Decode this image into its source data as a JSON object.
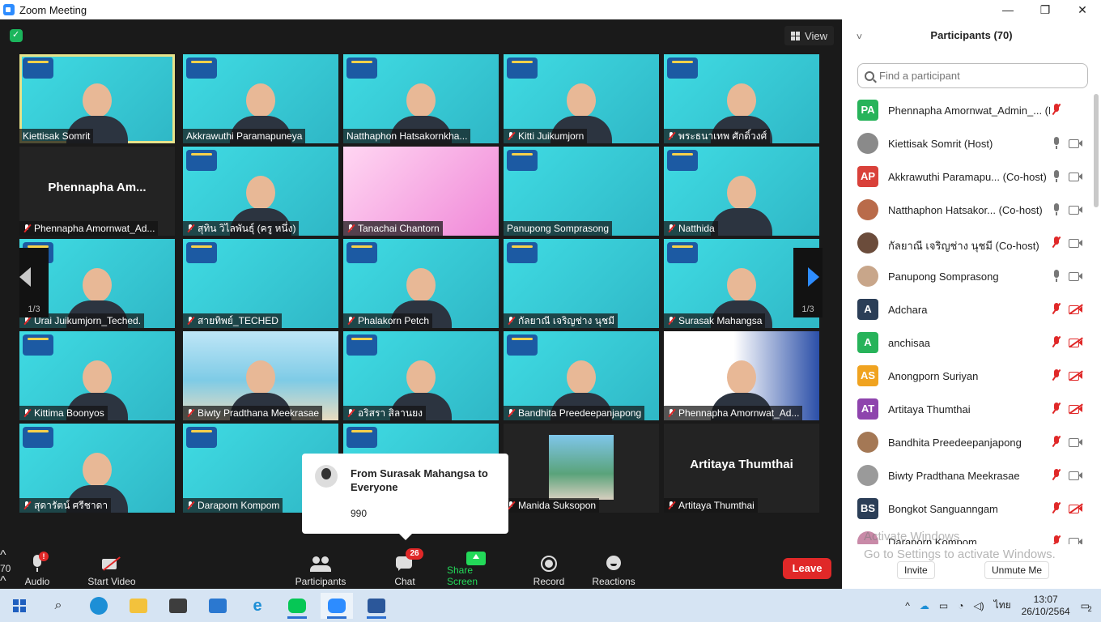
{
  "window": {
    "title": "Zoom Meeting",
    "controls": [
      "—",
      "❐",
      "✕"
    ]
  },
  "meeting": {
    "view_label": "View",
    "page_indicator": "1/3",
    "tiles": [
      {
        "name": "Kiettisak Somrit",
        "center": "",
        "kind": "cyan-person",
        "active": true,
        "muted": false
      },
      {
        "name": "Akkrawuthi Paramapuneya",
        "center": "",
        "kind": "cyan-person",
        "muted": false
      },
      {
        "name": "Natthaphon Hatsakornkha...",
        "center": "",
        "kind": "cyan-person",
        "muted": false
      },
      {
        "name": "Kitti Juikumjorn",
        "center": "",
        "kind": "cyan-person",
        "muted": true
      },
      {
        "name": "พระธนาเทพ ศักดิ์วงศ์",
        "center": "",
        "kind": "cyan-person",
        "muted": true
      },
      {
        "name": "Phennapha Amornwat_Ad...",
        "center": "Phennapha  Am...",
        "kind": "dark",
        "muted": true
      },
      {
        "name": "สุทิน วิไลพันธุ์ (ครู หนึ่ง)",
        "center": "",
        "kind": "cyan-person",
        "muted": true
      },
      {
        "name": "Tanachai Chantorn",
        "center": "",
        "kind": "pink",
        "muted": true
      },
      {
        "name": "Panupong Somprasong",
        "center": "",
        "kind": "cyan",
        "muted": false
      },
      {
        "name": "Natthida",
        "center": "",
        "kind": "cyan-person",
        "muted": true
      },
      {
        "name": "Urai Juikumjorn_Teched.",
        "center": "",
        "kind": "cyan-person",
        "muted": true
      },
      {
        "name": "สายทิพย์_TECHED",
        "center": "",
        "kind": "cyan",
        "muted": true
      },
      {
        "name": "Phalakorn Petch",
        "center": "",
        "kind": "cyan-person",
        "muted": true
      },
      {
        "name": "กัลยาณี เจริญช่าง นุชมี",
        "center": "",
        "kind": "cyan",
        "muted": true
      },
      {
        "name": "Surasak Mahangsa",
        "center": "",
        "kind": "cyan-person",
        "muted": true
      },
      {
        "name": "Kittima Boonyos",
        "center": "",
        "kind": "cyan-person",
        "muted": true
      },
      {
        "name": "Biwty Pradthana Meekrasae",
        "center": "",
        "kind": "beach",
        "muted": true
      },
      {
        "name": "อริสรา สิลานยง",
        "center": "",
        "kind": "cyan-person",
        "muted": true
      },
      {
        "name": "Bandhita Preedeepanjapong",
        "center": "",
        "kind": "cyan-person",
        "muted": true
      },
      {
        "name": "Phennapha Amornwat_Ad...",
        "center": "",
        "kind": "white-person",
        "muted": true
      },
      {
        "name": "สุดารัตน์ ศรีชาดา",
        "center": "",
        "kind": "cyan-person",
        "muted": true
      },
      {
        "name": "Daraporn Kompom",
        "center": "",
        "kind": "cyan",
        "muted": true
      },
      {
        "name": "",
        "center": "",
        "kind": "cyan",
        "muted": false
      },
      {
        "name": "Manida Suksopon",
        "center": "",
        "kind": "dark-photo",
        "muted": true
      },
      {
        "name": "Artitaya Thumthai",
        "center": "Artitaya Thumthai",
        "kind": "dark",
        "muted": true
      }
    ]
  },
  "chat_popup": {
    "from": "From Surasak Mahangsa to Everyone",
    "message": "990"
  },
  "toolbar": {
    "audio": "Audio",
    "audio_alert": "!",
    "start_video": "Start Video",
    "participants": "Participants",
    "participants_count": "70",
    "chat": "Chat",
    "chat_badge": "26",
    "share_screen": "Share Screen",
    "record": "Record",
    "reactions": "Reactions",
    "leave": "Leave"
  },
  "participants_panel": {
    "title": "Participants (70)",
    "search_placeholder": "Find a participant",
    "rows": [
      {
        "initials": "PA",
        "color": "#27b35a",
        "name": "Phennapha Amornwat_Admin_... (Me)",
        "mic": "muted",
        "cam": "none"
      },
      {
        "initials": "",
        "color": "#8a8a8a",
        "name": "Kiettisak Somrit (Host)",
        "mic": "on",
        "cam": "on"
      },
      {
        "initials": "AP",
        "color": "#d9413a",
        "name": "Akkrawuthi Paramapu... (Co-host)",
        "mic": "on",
        "cam": "on"
      },
      {
        "initials": "",
        "color": "#b96b4a",
        "name": "Natthaphon Hatsakor... (Co-host)",
        "mic": "on",
        "cam": "on"
      },
      {
        "initials": "",
        "color": "#6b4c3b",
        "name": "กัลยาณี เจริญช่าง นุชมี (Co-host)",
        "mic": "muted",
        "cam": "on"
      },
      {
        "initials": "",
        "color": "#c8a68a",
        "name": "Panupong Somprasong",
        "mic": "on",
        "cam": "on"
      },
      {
        "initials": "A",
        "color": "#2b3e57",
        "name": "Adchara",
        "mic": "muted",
        "cam": "off"
      },
      {
        "initials": "A",
        "color": "#27b35a",
        "name": "anchisaa",
        "mic": "muted",
        "cam": "off"
      },
      {
        "initials": "AS",
        "color": "#f0a320",
        "name": "Anongporn Suriyan",
        "mic": "muted",
        "cam": "off"
      },
      {
        "initials": "AT",
        "color": "#8e44ad",
        "name": "Artitaya Thumthai",
        "mic": "muted",
        "cam": "off"
      },
      {
        "initials": "",
        "color": "#a47855",
        "name": "Bandhita Preedeepanjapong",
        "mic": "muted",
        "cam": "on"
      },
      {
        "initials": "",
        "color": "#9a9a9a",
        "name": "Biwty Pradthana Meekrasae",
        "mic": "muted",
        "cam": "on"
      },
      {
        "initials": "BS",
        "color": "#2b3e57",
        "name": "Bongkot Sanguanngam",
        "mic": "muted",
        "cam": "off"
      },
      {
        "initials": "",
        "color": "#c98aa8",
        "name": "Daraporn Kompom",
        "mic": "muted",
        "cam": "on"
      }
    ],
    "watermark_line1": "Activate Windows",
    "watermark_line2": "Go to Settings to activate Windows.",
    "invite": "Invite",
    "unmute_me": "Unmute Me"
  },
  "taskbar": {
    "tray_lang": "ไทย",
    "time": "13:07",
    "date": "26/10/2564",
    "notifications": "2"
  }
}
